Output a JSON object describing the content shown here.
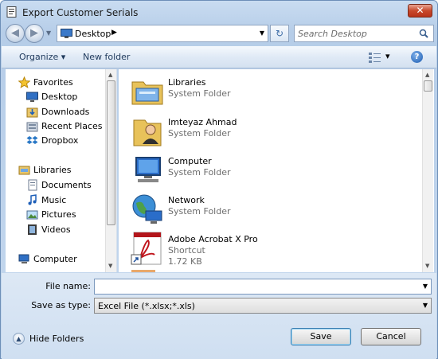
{
  "window": {
    "title": "Export Customer Serials",
    "close_glyph": "✕"
  },
  "navbar": {
    "back_glyph": "◀",
    "forward_glyph": "▶",
    "location": "Desktop",
    "crumb_arrow": "▶",
    "dropdown_glyph": "▼",
    "refresh_glyph": "↻",
    "search_placeholder": "Search Desktop"
  },
  "toolbar": {
    "organize_label": "Organize ▾",
    "new_folder_label": "New folder",
    "views_arrow": "▾",
    "help_glyph": "?"
  },
  "sidebar": {
    "favorites_label": "Favorites",
    "favorites": [
      {
        "label": "Desktop",
        "icon": "desktop-icon"
      },
      {
        "label": "Downloads",
        "icon": "downloads-icon"
      },
      {
        "label": "Recent Places",
        "icon": "recent-places-icon"
      },
      {
        "label": "Dropbox",
        "icon": "dropbox-icon"
      }
    ],
    "libraries_label": "Libraries",
    "libraries": [
      {
        "label": "Documents",
        "icon": "documents-icon"
      },
      {
        "label": "Music",
        "icon": "music-icon"
      },
      {
        "label": "Pictures",
        "icon": "pictures-icon"
      },
      {
        "label": "Videos",
        "icon": "videos-icon"
      }
    ],
    "computer_label": "Computer"
  },
  "files": [
    {
      "name": "Libraries",
      "type": "System Folder",
      "icon": "libraries-folder-icon"
    },
    {
      "name": "Imteyaz Ahmad",
      "type": "System Folder",
      "icon": "user-folder-icon"
    },
    {
      "name": "Computer",
      "type": "System Folder",
      "icon": "computer-icon"
    },
    {
      "name": "Network",
      "type": "System Folder",
      "icon": "network-icon"
    },
    {
      "name": "Adobe Acrobat X Pro",
      "type": "Shortcut",
      "size": "1.72 KB",
      "icon": "acrobat-shortcut-icon"
    }
  ],
  "form": {
    "filename_label": "File name:",
    "filename_value": "",
    "savetype_label": "Save as type:",
    "savetype_value": "Excel File (*.xlsx;*.xls)"
  },
  "footer": {
    "hide_folders_label": "Hide Folders",
    "hide_glyph": "▲",
    "save_label": "Save",
    "cancel_label": "Cancel"
  },
  "colors": {
    "title_bar": "#c9dcf1",
    "close_button": "#c8492c",
    "toolbar": "#e0eaf6",
    "link_text": "#1e395b"
  }
}
